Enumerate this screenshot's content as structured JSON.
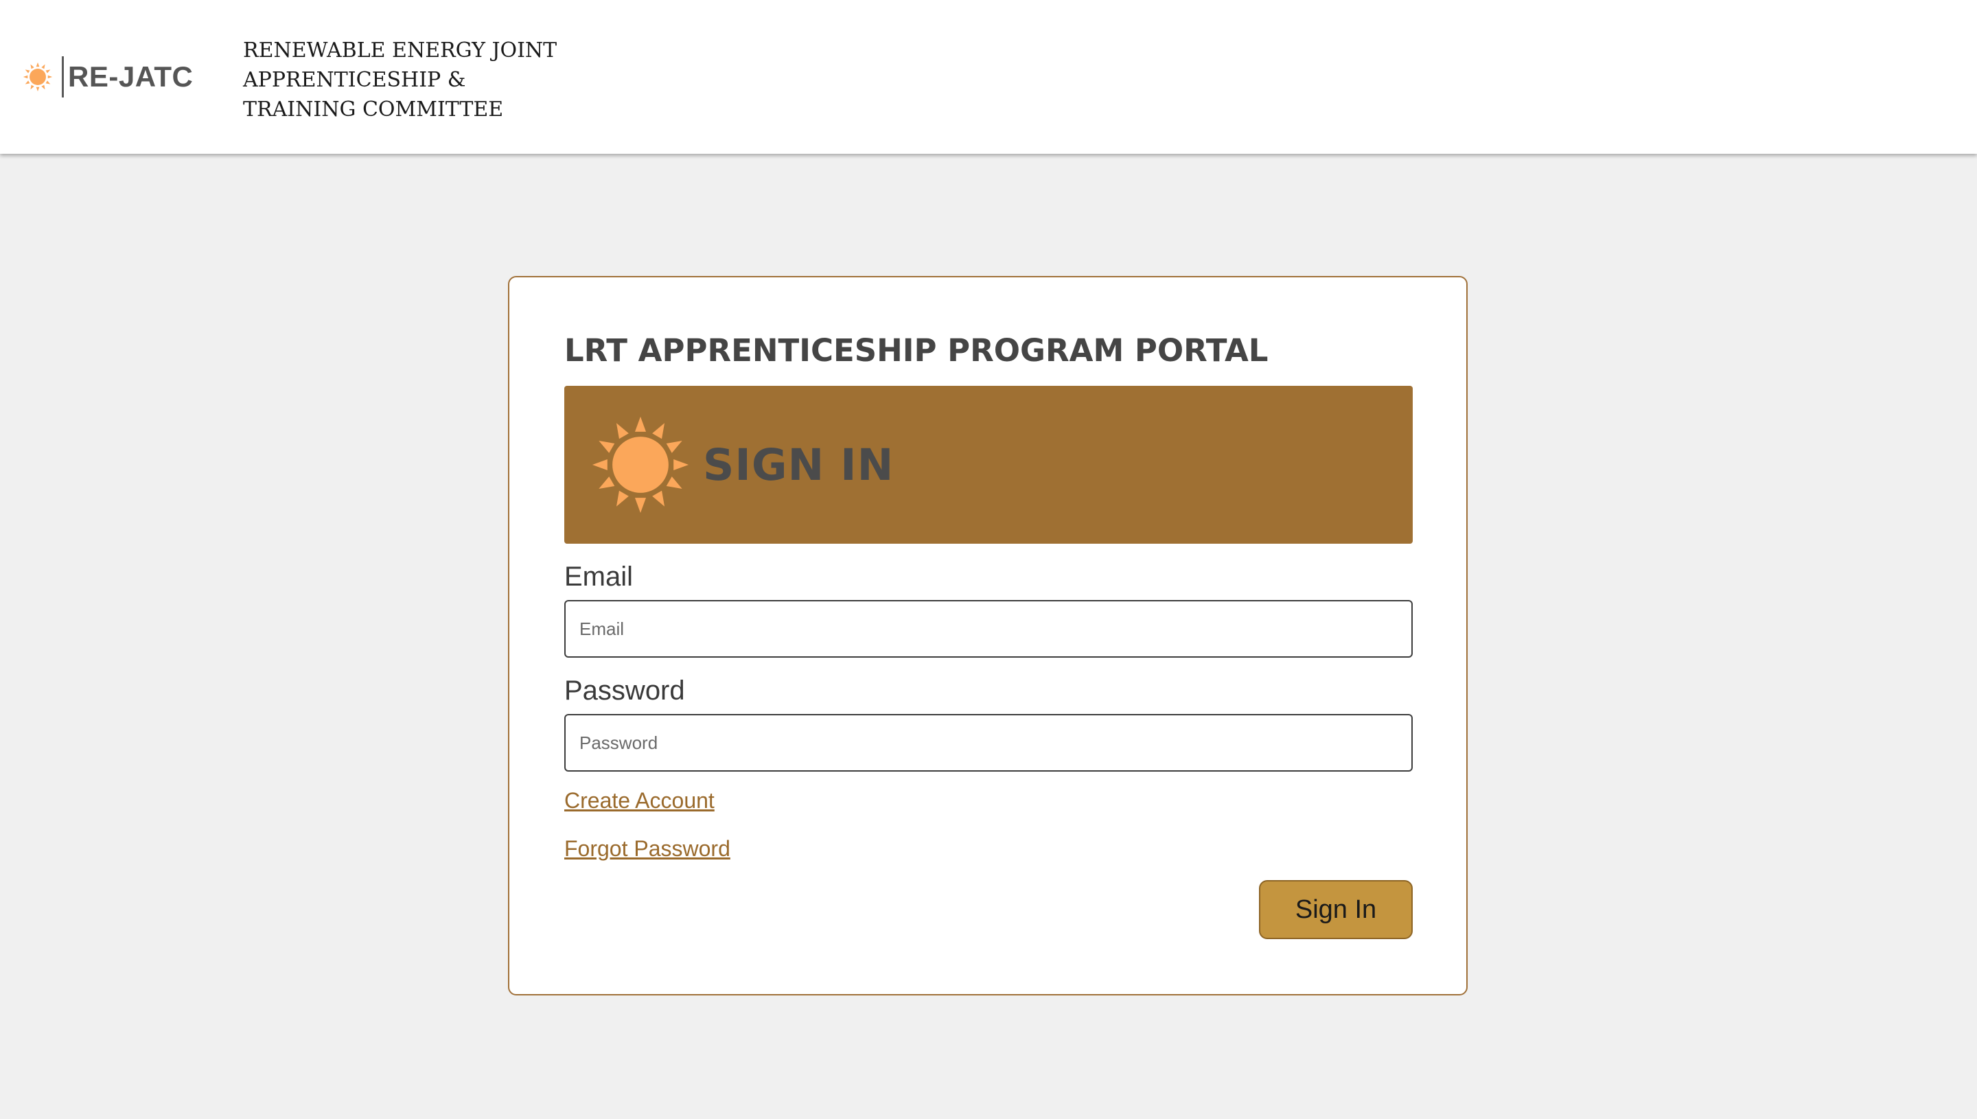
{
  "header": {
    "logo_text": "RE-JATC",
    "org_name_lines": [
      "RENEWABLE ENERGY JOINT",
      "APPRENTICESHIP &",
      "TRAINING COMMITTEE"
    ]
  },
  "login": {
    "title": "LRT APPRENTICESHIP PROGRAM PORTAL",
    "banner_title": "SIGN IN",
    "email_label": "Email",
    "email_placeholder": "Email",
    "email_value": "",
    "password_label": "Password",
    "password_placeholder": "Password",
    "password_value": "",
    "create_account_label": "Create Account",
    "forgot_password_label": "Forgot Password",
    "signin_button_label": "Sign In"
  },
  "icons": {
    "logo": "sun-icon",
    "banner": "sun-icon"
  },
  "colors": {
    "page_background": "#f0f0f0",
    "banner_background": "#9f7033",
    "sun": "#fba75a",
    "accent_link": "#9a6a2c",
    "button_background": "#c4953f",
    "card_border": "#a07038"
  }
}
